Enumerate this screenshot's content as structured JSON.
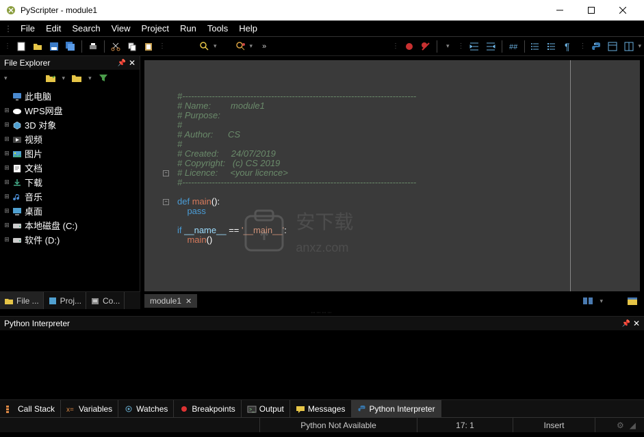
{
  "window": {
    "title": "PyScripter - module1"
  },
  "menu": [
    "File",
    "Edit",
    "Search",
    "View",
    "Project",
    "Run",
    "Tools",
    "Help"
  ],
  "file_explorer": {
    "title": "File Explorer",
    "items": [
      {
        "expand": "",
        "icon": "pc",
        "label": "此电脑"
      },
      {
        "expand": "⊞",
        "icon": "cloud",
        "label": "WPS网盘"
      },
      {
        "expand": "⊞",
        "icon": "3d",
        "label": "3D 对象"
      },
      {
        "expand": "⊞",
        "icon": "video",
        "label": "视频"
      },
      {
        "expand": "⊞",
        "icon": "image",
        "label": "图片"
      },
      {
        "expand": "⊞",
        "icon": "doc",
        "label": "文档"
      },
      {
        "expand": "⊞",
        "icon": "download",
        "label": "下载"
      },
      {
        "expand": "⊞",
        "icon": "music",
        "label": "音乐"
      },
      {
        "expand": "⊞",
        "icon": "desktop",
        "label": "桌面"
      },
      {
        "expand": "⊞",
        "icon": "disk",
        "label": "本地磁盘 (C:)"
      },
      {
        "expand": "⊞",
        "icon": "disk",
        "label": "软件 (D:)"
      }
    ]
  },
  "sidebar_tabs": [
    {
      "label": "File ...",
      "active": true
    },
    {
      "label": "Proj...",
      "active": false
    },
    {
      "label": "Co...",
      "active": false
    }
  ],
  "editor": {
    "tab": "module1",
    "code_lines": [
      {
        "t": "cmt",
        "text": "#-------------------------------------------------------------------------------"
      },
      {
        "t": "cmt",
        "text": "# Name:        module1"
      },
      {
        "t": "cmt",
        "text": "# Purpose:"
      },
      {
        "t": "cmt",
        "text": "#"
      },
      {
        "t": "cmt",
        "text": "# Author:      CS"
      },
      {
        "t": "cmt",
        "text": "#"
      },
      {
        "t": "cmt",
        "text": "# Created:     24/07/2019"
      },
      {
        "t": "cmt",
        "text": "# Copyright:   (c) CS 2019"
      },
      {
        "t": "cmt",
        "text": "# Licence:     <your licence>"
      },
      {
        "t": "cmt",
        "text": "#-------------------------------------------------------------------------------"
      },
      {
        "t": "blank",
        "text": ""
      },
      {
        "t": "def",
        "kw": "def ",
        "fn": "main",
        "rest": "():"
      },
      {
        "t": "pass",
        "indent": "    ",
        "kw": "pass"
      },
      {
        "t": "blank",
        "text": ""
      },
      {
        "t": "if",
        "kw": "if ",
        "id": "__name__",
        "op": " == ",
        "str": "'__main__'",
        "rest": ":"
      },
      {
        "t": "call",
        "indent": "    ",
        "fn": "main",
        "rest": "()"
      }
    ]
  },
  "interpreter": {
    "title": "Python Interpreter"
  },
  "bottom_tabs": [
    "Call Stack",
    "Variables",
    "Watches",
    "Breakpoints",
    "Output",
    "Messages",
    "Python Interpreter"
  ],
  "status": {
    "python": "Python Not Available",
    "pos": "17:  1",
    "mode": "Insert"
  },
  "watermark": {
    "cn": "安下载",
    "en": "anxz.com"
  }
}
